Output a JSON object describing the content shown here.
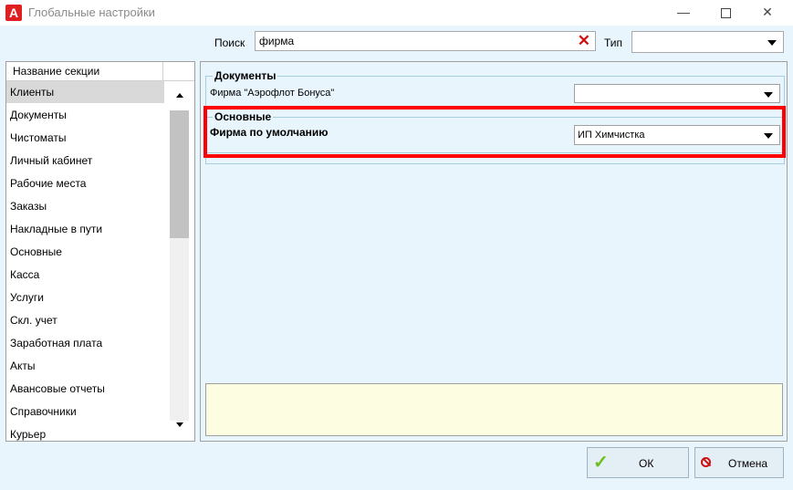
{
  "window": {
    "title": "Глобальные настройки"
  },
  "search": {
    "label": "Поиск",
    "value": "фирма",
    "type_label": "Тип",
    "type_value": ""
  },
  "sections": {
    "header": "Название секции",
    "items": [
      "Клиенты",
      "Документы",
      "Чистоматы",
      "Личный кабинет",
      "Рабочие места",
      "Заказы",
      "Накладные в пути",
      "Основные",
      "Касса",
      "Услуги",
      "Скл. учет",
      "Заработная плата",
      "Акты",
      "Авансовые отчеты",
      "Справочники",
      "Курьер"
    ],
    "selected": "Клиенты"
  },
  "settings": {
    "documents_group": {
      "title": "Документы",
      "field_label": "Фирма \"Аэрофлот Бонуса\"",
      "field_value": ""
    },
    "main_group": {
      "title": "Основные",
      "field_label": "Фирма по умолчанию",
      "field_value": "ИП Химчистка"
    }
  },
  "buttons": {
    "ok": "ОК",
    "cancel": "Отмена"
  },
  "colors": {
    "accent_highlight": "#ff0000",
    "panel_bg": "#e8f5fc",
    "info_bg": "#fdfde2"
  }
}
